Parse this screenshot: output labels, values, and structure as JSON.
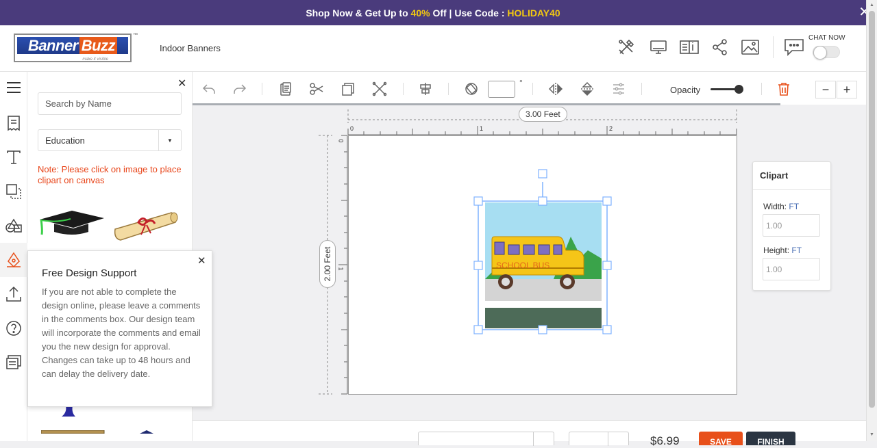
{
  "promo": {
    "prefix": "Shop Now & Get Up to ",
    "percent": "40%",
    "middle": " Off | Use Code : ",
    "code": "HOLIDAY40",
    "accent_color": "#f2c811",
    "bg_color": "#4a3b7c"
  },
  "header": {
    "logo_left": "Banner",
    "logo_right": "Buzz",
    "logo_tm": "™",
    "logo_tagline": "make it visible",
    "product_name": "Indoor Banners",
    "chat_label": "CHAT NOW"
  },
  "panel": {
    "search_placeholder": "Search by Name",
    "category": "Education",
    "note": "Note: Please click on image to place clipart on canvas"
  },
  "toolbar": {
    "rotation_value": "",
    "degree_symbol": "°",
    "opacity_label": "Opacity",
    "opacity_value": 1.0,
    "zoom_out": "−",
    "zoom_in": "+"
  },
  "canvas": {
    "width_label": "3.00 Feet",
    "height_label": "2.00 Feet",
    "ruler_x": [
      "0",
      "1",
      "2"
    ],
    "ruler_y": [
      "0",
      "1"
    ],
    "clipart_text": "SCHOOL BUS"
  },
  "clipart_panel": {
    "title": "Clipart",
    "width_label": "Width:",
    "width_unit": "FT",
    "width_value": "1.00",
    "height_label": "Height:",
    "height_unit": "FT",
    "height_value": "1.00"
  },
  "popup": {
    "title": "Free Design Support",
    "body": "If you are not able to complete the design online, please leave a comments in the comments box. Our design team will incorporate the comments and email you the new design for approval. Changes can take up to 48 hours and can delay the delivery date."
  },
  "bottom": {
    "price": "$6.99",
    "save_label": "SAVE",
    "finish_label": "FINISH"
  },
  "colors": {
    "accent_orange": "#e8501a",
    "dark_button": "#2b3542",
    "note_red": "#e8451a"
  }
}
